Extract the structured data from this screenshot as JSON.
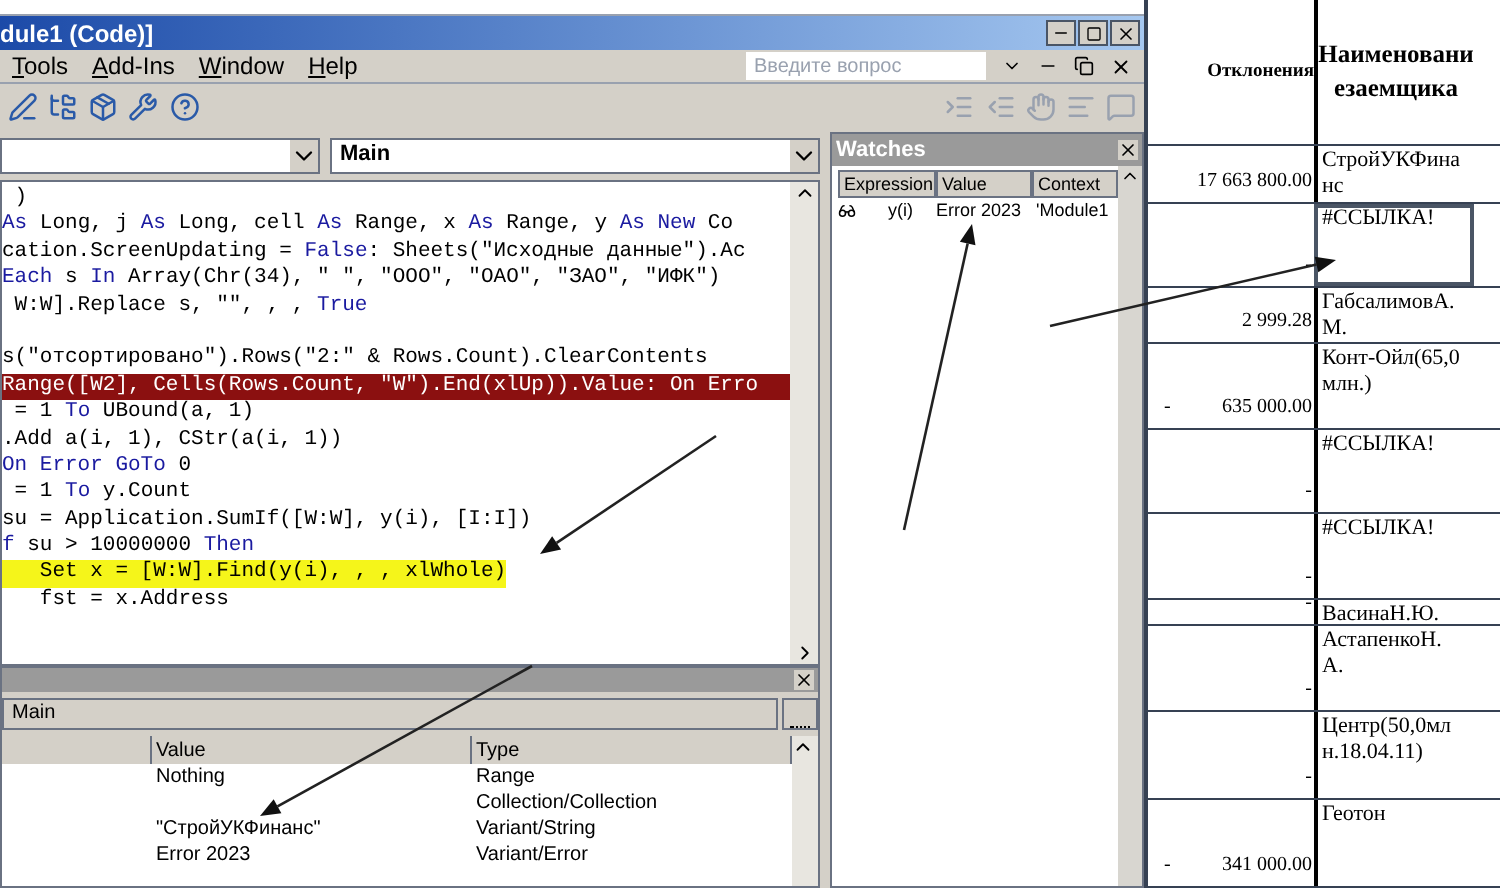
{
  "vbe": {
    "title": "dule1 (Code)]",
    "menu": [
      "Tools",
      "Add-Ins",
      "Window",
      "Help"
    ],
    "question_box": {
      "placeholder": "Введите вопрос"
    },
    "procedure_combo": {
      "value": "Main"
    },
    "code_lines": [
      {
        "kind": "normal",
        "segments": [
          {
            "t": " )",
            "kind": "plain"
          }
        ]
      },
      {
        "kind": "normal",
        "segments": [
          {
            "t": "As",
            "kind": "keyword"
          },
          {
            "t": " Long, j ",
            "kind": "plain"
          },
          {
            "t": "As",
            "kind": "keyword"
          },
          {
            "t": " Long, cell ",
            "kind": "plain"
          },
          {
            "t": "As",
            "kind": "keyword"
          },
          {
            "t": " Range, x ",
            "kind": "plain"
          },
          {
            "t": "As",
            "kind": "keyword"
          },
          {
            "t": " Range, y ",
            "kind": "plain"
          },
          {
            "t": "As New",
            "kind": "keyword"
          },
          {
            "t": " Co",
            "kind": "plain"
          }
        ]
      },
      {
        "kind": "normal",
        "segments": [
          {
            "t": "cation.ScreenUpdating = ",
            "kind": "plain"
          },
          {
            "t": "False",
            "kind": "keyword"
          },
          {
            "t": ": Sheets(\"Исходные данные\").Ac",
            "kind": "plain"
          }
        ]
      },
      {
        "kind": "normal",
        "segments": [
          {
            "t": "Each",
            "kind": "keyword"
          },
          {
            "t": " s ",
            "kind": "plain"
          },
          {
            "t": "In",
            "kind": "keyword"
          },
          {
            "t": " Array(Chr(34), \" \", \"ООО\", \"ОАО\", \"ЗАО\", \"ИФК\")",
            "kind": "plain"
          }
        ]
      },
      {
        "kind": "normal",
        "segments": [
          {
            "t": " W:W].Replace s, \"\", , , ",
            "kind": "plain"
          },
          {
            "t": "True",
            "kind": "keyword"
          }
        ]
      },
      {
        "kind": "blank"
      },
      {
        "kind": "normal",
        "segments": [
          {
            "t": "s(\"отсортировано\").Rows(\"2:\" & Rows.Count).ClearContents",
            "kind": "plain"
          }
        ]
      },
      {
        "kind": "breakpoint",
        "segments": [
          {
            "t": "Range([W2], Cells(Rows.Count, \"W\").End(xlUp)).Value: On Erro"
          }
        ]
      },
      {
        "kind": "normal",
        "segments": [
          {
            "t": " = 1 ",
            "kind": "plain"
          },
          {
            "t": "To",
            "kind": "keyword"
          },
          {
            "t": " UBound(a, 1)",
            "kind": "plain"
          }
        ]
      },
      {
        "kind": "normal",
        "segments": [
          {
            "t": ".Add a(i, 1), CStr(a(i, 1))",
            "kind": "plain"
          }
        ]
      },
      {
        "kind": "normal",
        "segments": [
          {
            "t": "On Error GoTo",
            "kind": "keyword"
          },
          {
            "t": " 0",
            "kind": "plain"
          }
        ]
      },
      {
        "kind": "normal",
        "segments": [
          {
            "t": " = 1 ",
            "kind": "plain"
          },
          {
            "t": "To",
            "kind": "keyword"
          },
          {
            "t": " y.Count",
            "kind": "plain"
          }
        ]
      },
      {
        "kind": "normal",
        "segments": [
          {
            "t": "su = Application.SumIf([W:W], y(i), [I:I])",
            "kind": "plain"
          }
        ]
      },
      {
        "kind": "normal",
        "segments": [
          {
            "t": "f",
            "kind": "keyword"
          },
          {
            "t": " su > 10000000 ",
            "kind": "plain"
          },
          {
            "t": "Then",
            "kind": "keyword"
          }
        ]
      },
      {
        "kind": "current",
        "segments": [
          {
            "t": "   Set x = [W:W].Find(y(i), , , xlWhole)"
          }
        ]
      },
      {
        "kind": "normal",
        "segments": [
          {
            "t": "   fst = x.Address",
            "kind": "plain"
          }
        ]
      }
    ],
    "watches": {
      "title": "Watches",
      "columns": [
        "Expression",
        "Value",
        "Context"
      ],
      "rows": [
        {
          "expression": "y(i)",
          "value": "Error 2023",
          "context": "'Module1"
        }
      ]
    },
    "locals": {
      "procedure": "Main",
      "columns": [
        "Value",
        "Type"
      ],
      "rows": [
        {
          "value": "Nothing",
          "type": "Range"
        },
        {
          "type": "Collection/Collection"
        },
        {
          "value": "\"СтройУКФинанс\"",
          "type": "Variant/String"
        },
        {
          "value": "Error 2023",
          "type": "Variant/Error"
        }
      ]
    }
  },
  "sheet": {
    "columns": [
      "Отклонения",
      "Наименованиезаемщика"
    ],
    "rows": [
      {
        "deviation": "17 663 800.00",
        "name": "СтройУКФинанс",
        "selected": false
      },
      {
        "deviation": "-",
        "name": "#ССЫЛКА!",
        "selected": true
      },
      {
        "deviation": "2 999.28",
        "name": "ГабсалимовА.М.",
        "selected": false
      },
      {
        "sign": "-",
        "deviation": "635 000.00",
        "name": "Конт-Ойл(65,0млн.)",
        "selected": false
      },
      {
        "deviation": "-",
        "name": "#ССЫЛКА!",
        "selected": false
      },
      {
        "deviation": "-",
        "name": "#ССЫЛКА!",
        "selected": false
      },
      {
        "deviation": "-",
        "name": "ВасинаН.Ю.",
        "selected": false
      },
      {
        "deviation": "-",
        "name": "АстапенкоН.А.",
        "selected": false
      },
      {
        "deviation": "-",
        "name": "Центр(50,0млн.18.04.11)",
        "selected": false
      },
      {
        "sign": "-",
        "deviation": "341 000.00",
        "name": "Геотон",
        "selected": false
      }
    ]
  }
}
